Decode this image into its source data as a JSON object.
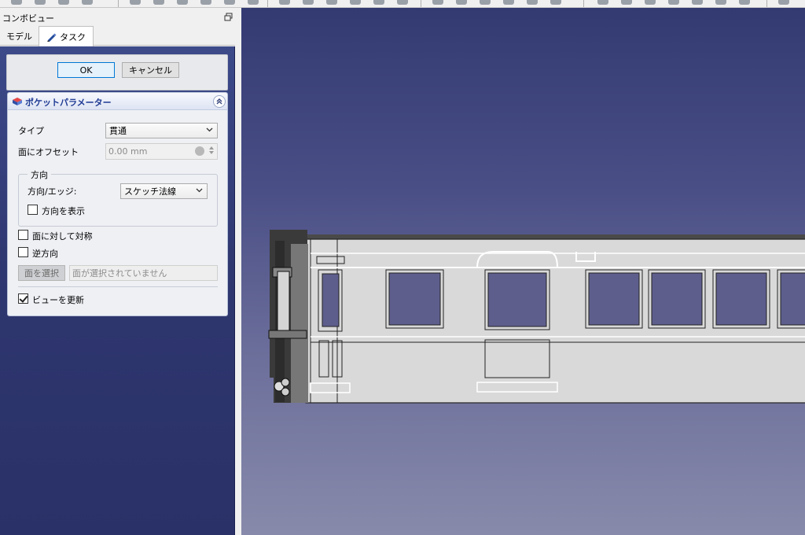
{
  "combo_view": {
    "title": "コンボビュー",
    "tabs": [
      {
        "label": "モデル"
      },
      {
        "label": "タスク"
      }
    ]
  },
  "dialog": {
    "ok_label": "OK",
    "cancel_label": "キャンセル"
  },
  "pocket_params": {
    "title": "ポケットパラメーター",
    "type_label": "タイプ",
    "type_value": "貫通",
    "offset_label": "面にオフセット",
    "offset_value": "0.00 mm",
    "direction": {
      "group_title": "方向",
      "edge_label": "方向/エッジ:",
      "edge_value": "スケッチ法線",
      "show_direction_label": "方向を表示",
      "show_direction_checked": false
    },
    "symmetric_label": "面に対して対称",
    "symmetric_checked": false,
    "reversed_label": "逆方向",
    "reversed_checked": false,
    "select_face_label": "面を選択",
    "face_placeholder": "面が選択されていません",
    "update_view_label": "ビューを更新",
    "update_view_checked": true
  },
  "colors": {
    "accent": "#0078d7",
    "panel_title": "#1f3a93",
    "view_top": "#333a72",
    "view_bottom": "#888aab"
  }
}
